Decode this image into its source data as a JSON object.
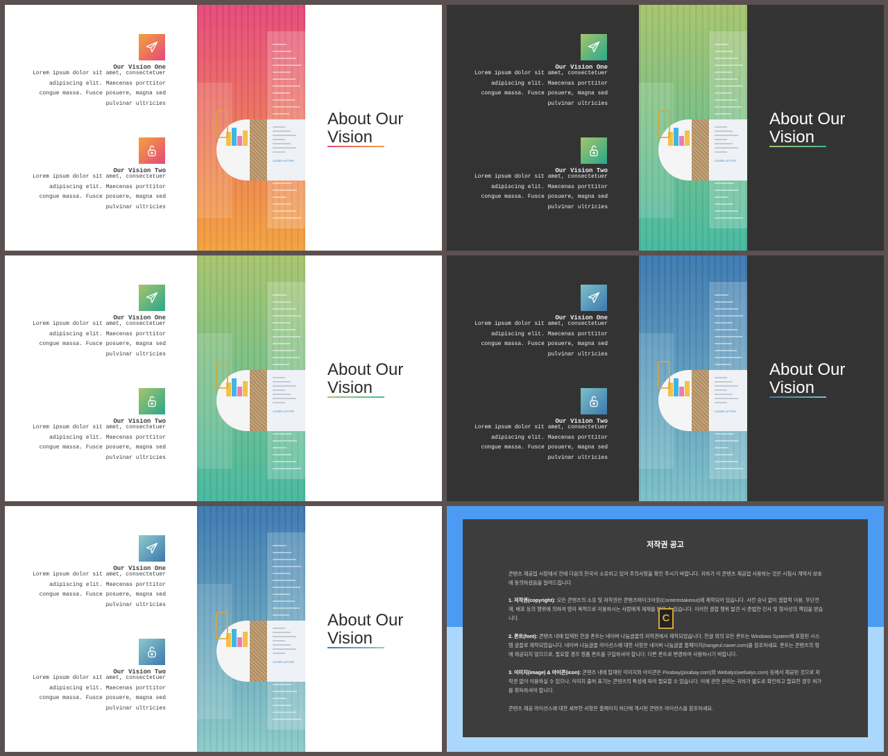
{
  "slide_title": "About Our Vision",
  "title_line1": "About Our",
  "title_line2": "Vision",
  "vision_one": {
    "title": "Our Vision One",
    "lines": [
      "Lorem ipsum dolor sit amet, consectetuer",
      "adipiscing elit. Maecenas porttitor",
      "congue massa. Fusce posuere, magna sed",
      "pulvinar ultricies"
    ]
  },
  "vision_two": {
    "title": "Our Vision Two",
    "lines": [
      "Lorem ipsum dolor sit amet, consectetuer",
      "adipiscing elit. Maecenas porttitor",
      "congue massa. Fusce posuere, magna sed",
      "pulvinar ultricies"
    ]
  },
  "monitor_label": "COVER LETTER",
  "icons": [
    "paper-plane-icon",
    "open-padlock-icon"
  ],
  "themes": [
    {
      "bg": "light",
      "from": "#e5487a",
      "to": "#f3a23c",
      "icon_from": "#f3a23c",
      "icon_to": "#e5487a"
    },
    {
      "bg": "dark",
      "from": "#a6c46c",
      "to": "#45b8a0",
      "icon_from": "#a6c46c",
      "icon_to": "#28a88a"
    },
    {
      "bg": "light",
      "from": "#a6c46c",
      "to": "#45b8a0",
      "icon_from": "#a6c46c",
      "icon_to": "#28a88a"
    },
    {
      "bg": "dark",
      "from": "#3c78b0",
      "to": "#7cc0c8",
      "icon_from": "#7cc0c8",
      "icon_to": "#3c78b0"
    },
    {
      "bg": "light",
      "from": "#3c78b0",
      "to": "#8ccbc9",
      "icon_from": "#8ccbc9",
      "icon_to": "#3c78b0"
    }
  ],
  "copyright": {
    "title": "저작권 공고",
    "intro": "콘텐츠 제공업 시장에서 전에 다음의 한국서 소유하고 있어 주의사항을 확인 주시기 바랍니다. 귀하가 이 콘텐츠 제공업 사용하는 것은 시험시 계약서 보호에 동의하셨음을 알려드립니다.",
    "s1_label": "1. 저작권(copyright):",
    "s1_text": "모든 콘텐츠의 소유 및 저작권은 콘텐츠테이크아웃(Contentstakeout)에 제작되어 있습니다. 사전 승낙 없이 결합적 이용, 무단전재, 배포 등의 행위에 의하여 영리 목적으로 이용하시는 사람에게 제재를 받을 수 있습니다. 이러한 결합 행위 발견 시 준법한 민사 및 형사상의 책임을 받습니다.",
    "s2_label": "2. 폰트(font):",
    "s2_text": "콘텐츠 내에 탑재된 한글 폰트는 네이버 나눔글꼴의 저작권에서 제작되었습니다. 한글 외의 모든 폰트는 Windows System에 포함된 시스템 글꼴로 제작되었습니다. 네이버 나눔글꼴 라이선스에 대한 사항은 네이버 나눔글꼴 홈페이지(hangeul.naver.com)를 참조하세요. 폰트는 콘텐츠의 형에 제공되지 않으므로, 필요할 경우 정품 폰트를 구입하셔야 합니다. 다른 폰트로 변경하여 사용하시기 바랍니다.",
    "s3_label": "3. 이미지(image) & 아이콘(icon):",
    "s3_text": "콘텐츠 내에 탑재된 이미지와 아이콘은 Pixabay(pixabay.com)와 Webalys(webalys.com) 등에서 제공된 것으로 저작권 없이 이용하실 수 있으나, 이미지 출처 표기는 콘텐츠의 특성에 따라 필요할 수 있습니다. 이에 관한 관리는 귀하가 별도로 확인하고 필요한 경우 허가를 취득하셔야 합니다.",
    "footer": "콘텐츠 제공 라이선스에 대한 세부한 사항은 홈페이지 하단에 게시된 콘텐츠 라이선스를 참조하세요."
  }
}
